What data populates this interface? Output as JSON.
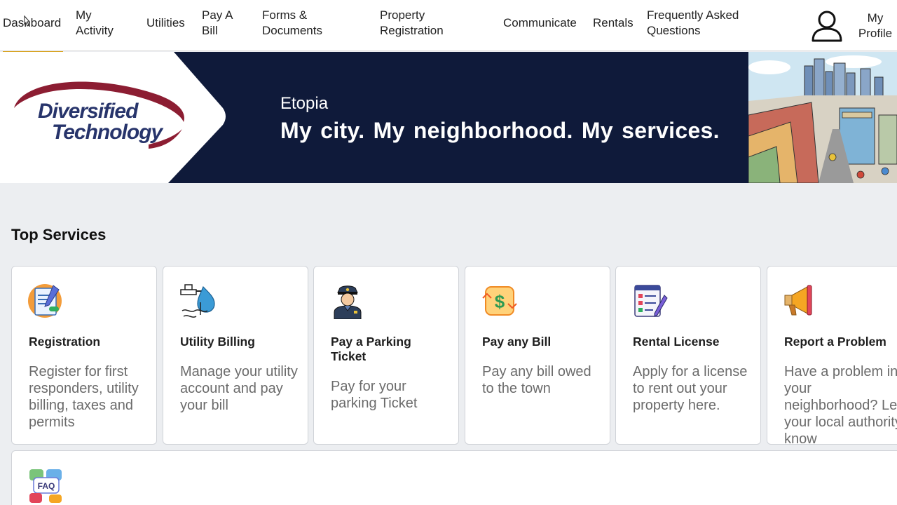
{
  "nav": {
    "items": [
      {
        "label": "Dashboard"
      },
      {
        "label": "My Activity"
      },
      {
        "label": "Utilities"
      },
      {
        "label": "Pay A Bill"
      },
      {
        "label": "Forms & Documents"
      },
      {
        "label": "Property Registration"
      },
      {
        "label": "Communicate"
      },
      {
        "label": "Rentals"
      },
      {
        "label": "Frequently Asked Questions"
      }
    ],
    "profile_label": "My Profile",
    "active_color": "#d9a21b"
  },
  "hero": {
    "logo_line1": "Diversified",
    "logo_line2": "Technology",
    "city": "Etopia",
    "tagline": "My city. My neighborhood. My services.",
    "bg_color": "#0f1a3a"
  },
  "services": {
    "title": "Top Services",
    "cards": [
      {
        "icon": "registration-icon",
        "title": "Registration",
        "desc": "Register for first responders, utility billing, taxes and permits"
      },
      {
        "icon": "water-tap-icon",
        "title": "Utility Billing",
        "desc": "Manage your utility account and pay your bill"
      },
      {
        "icon": "police-officer-icon",
        "title": "Pay a Parking Ticket",
        "desc": "Pay for your parking Ticket"
      },
      {
        "icon": "dollar-bill-icon",
        "title": "Pay any Bill",
        "desc": "Pay any bill owed to the town"
      },
      {
        "icon": "checklist-icon",
        "title": "Rental License",
        "desc": "Apply for a license to rent out your property here."
      },
      {
        "icon": "megaphone-icon",
        "title": "Report a Problem",
        "desc": "Have a problem in your neighborhood? Let your local authority know"
      }
    ],
    "faq_icon": "faq-icon",
    "faq_label": "FAQ"
  }
}
